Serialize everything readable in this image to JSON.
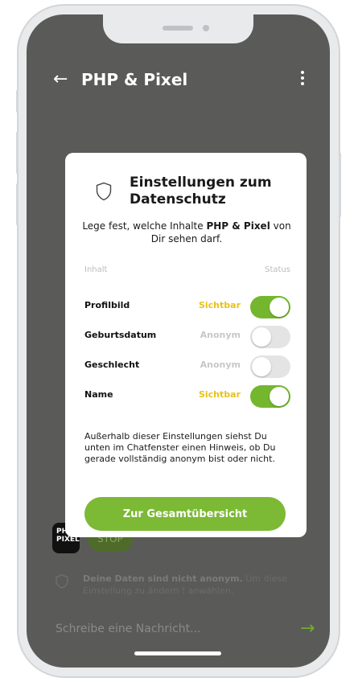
{
  "chat": {
    "back_icon": "←",
    "title": "PHP & Pixel",
    "logo_text": "PHP PIXEL",
    "stop_label": "STOP",
    "info_bold": "Deine Daten sind nicht anonym.",
    "info_rest": " Um diese Einstellung zu ändern  !  anwählen.",
    "message_placeholder": "Schreibe eine Nachricht...",
    "send_icon": "→"
  },
  "modal": {
    "title": "Einstellungen zum Datenschutz",
    "subtitle_prefix": "Lege fest, welche Inhalte ",
    "subtitle_bold": "PHP & Pixel",
    "subtitle_suffix": " von Dir sehen darf.",
    "col_content": "Inhalt",
    "col_status": "Status",
    "rows": [
      {
        "label": "Profilbild",
        "status": "Sichtbar",
        "enabled": true
      },
      {
        "label": "Geburtsdatum",
        "status": "Anonym",
        "enabled": false
      },
      {
        "label": "Geschlecht",
        "status": "Anonym",
        "enabled": false
      },
      {
        "label": "Name",
        "status": "Sichtbar",
        "enabled": true
      }
    ],
    "explanation": "Außerhalb dieser Einstellungen siehst Du unten im Chatfenster einen Hinweis, ob Du gerade vollständig anonym bist oder nicht.",
    "button_label": "Zur Gesamtübersicht"
  },
  "colors": {
    "accent_green": "#7cb935",
    "status_visible": "#e8c21a",
    "status_anonymous": "#c7c7c7",
    "overlay_bg": "#5a5a59"
  }
}
